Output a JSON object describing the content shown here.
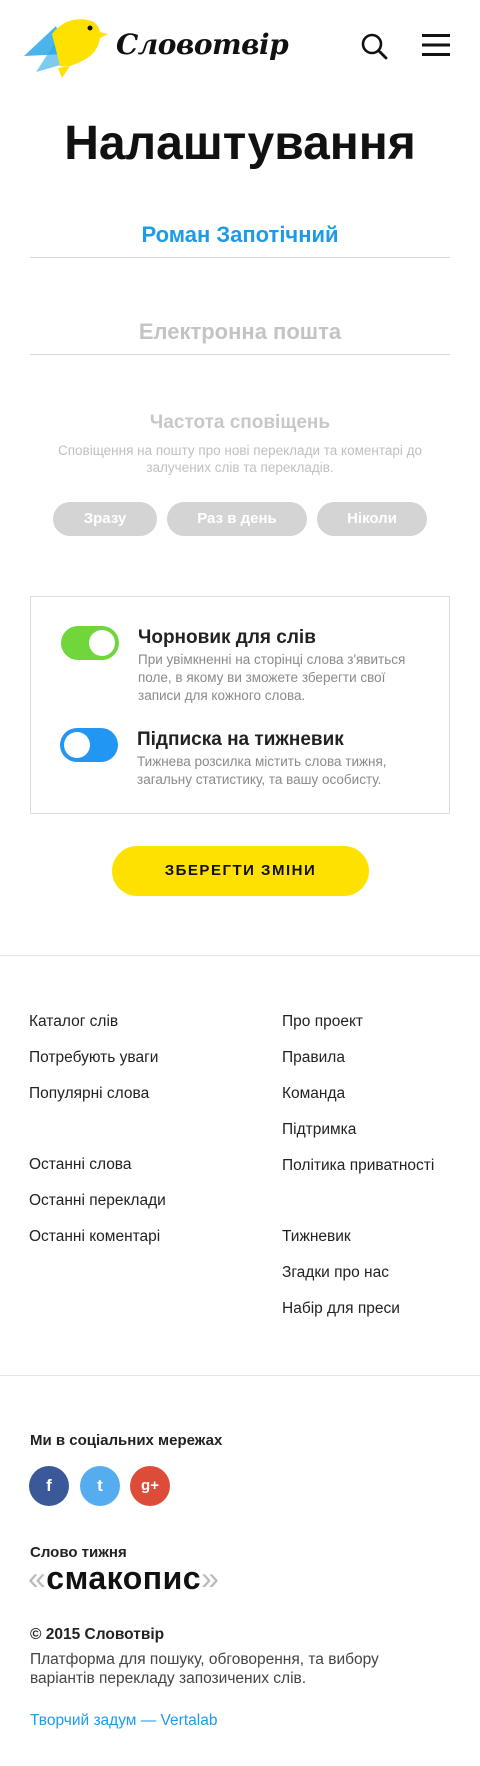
{
  "brand": {
    "logo_text": "Словотвір"
  },
  "header": {
    "search_icon": "search-icon",
    "menu_icon": "hamburger-menu-icon"
  },
  "settings": {
    "title": "Налаштування",
    "name_value": "Роман Запотічний",
    "email_placeholder": "Електронна пошта",
    "frequency": {
      "title": "Частота сповіщень",
      "description": "Сповіщення на пошту про нові переклади та коментарі до залучених слів та перекладів.",
      "options": [
        "Зразу",
        "Раз в день",
        "Ніколи"
      ]
    },
    "toggles": [
      {
        "title": "Чорновик для слів",
        "description": "При увімкненні на сторінці слова з'явиться поле, в якому ви зможете зберегти свої записи для кожного слова.",
        "on": true,
        "color": "#6fd63c"
      },
      {
        "title": "Підписка на тижневик",
        "description": "Тижнева розсилка містить слова тижня, загальну статистику, та вашу особисту.",
        "on": false,
        "color": "#2196f3"
      }
    ],
    "save_label": "ЗБЕРЕГТИ ЗМІНИ"
  },
  "footer": {
    "left_group_1": [
      "Каталог слів",
      "Потребують уваги",
      "Популярні слова"
    ],
    "left_group_2": [
      "Останні слова",
      "Останні переклади",
      "Останні коментарі"
    ],
    "right_group_1": [
      "Про проект",
      "Правила",
      "Команда",
      "Підтримка",
      "Політика приватності"
    ],
    "right_group_2": [
      "Тижневик",
      "Згадки про нас",
      "Набір для преси"
    ],
    "social_title": "Ми в соціальних мережах",
    "social": [
      {
        "name": "facebook",
        "glyph": "f",
        "color": "#3b5998"
      },
      {
        "name": "twitter",
        "glyph": "t",
        "color": "#55acee"
      },
      {
        "name": "google-plus",
        "glyph": "g+",
        "color": "#dd4b39"
      }
    ],
    "word_of_week_title": "Слово тижня",
    "word_of_week": "смакопис",
    "copyright": "© 2015 Словотвір",
    "description": "Платформа для пошуку, обговорення, та вибору варіантів перекладу запозичених слів.",
    "credit": "Творчий задум — Vertalab"
  },
  "colors": {
    "accent_blue": "#1e9be8",
    "accent_yellow": "#ffe100",
    "toggle_green": "#6fd63c",
    "toggle_blue": "#2196f3"
  }
}
